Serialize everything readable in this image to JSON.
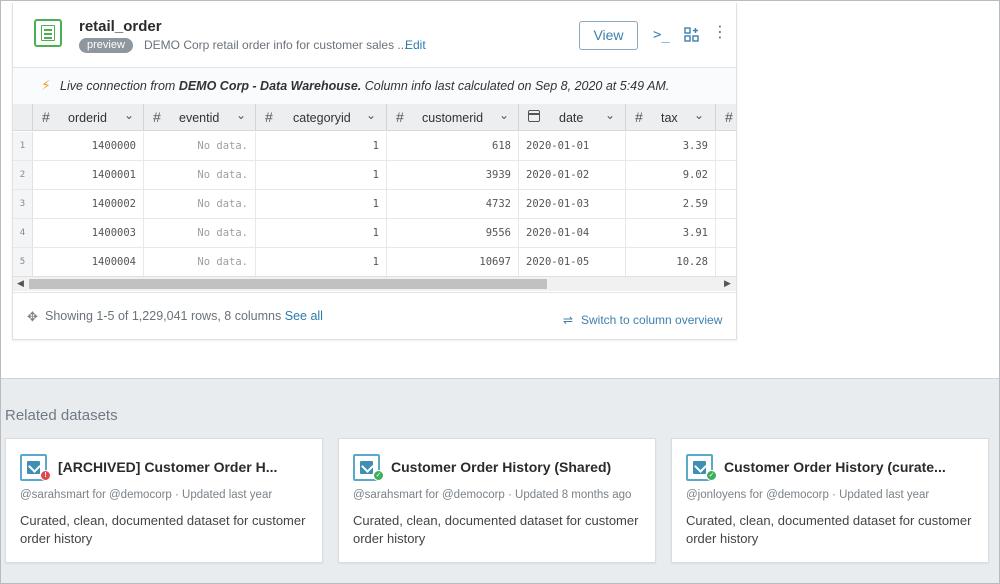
{
  "dataset": {
    "title": "retail_order",
    "badge": "preview",
    "description": "DEMO Corp retail order info for customer sales ...",
    "edit_label": "Edit",
    "view_label": "View",
    "icons": [
      "terminal-icon",
      "apps-icon",
      "more-icon"
    ]
  },
  "live_bar": {
    "prefix": "Live connection from ",
    "source": "DEMO Corp - Data Warehouse.",
    "suffix": " Column info last calculated on Sep 8, 2020 at 5:49 AM."
  },
  "table": {
    "columns": [
      {
        "name": "orderid",
        "type": "number"
      },
      {
        "name": "eventid",
        "type": "number"
      },
      {
        "name": "categoryid",
        "type": "number"
      },
      {
        "name": "customerid",
        "type": "number"
      },
      {
        "name": "date",
        "type": "date"
      },
      {
        "name": "tax",
        "type": "number"
      }
    ],
    "rows": [
      {
        "num": "1",
        "cells": [
          "1400000",
          "No data.",
          "1",
          "618",
          "2020-01-01",
          "3.39"
        ]
      },
      {
        "num": "2",
        "cells": [
          "1400001",
          "No data.",
          "1",
          "3939",
          "2020-01-02",
          "9.02"
        ]
      },
      {
        "num": "3",
        "cells": [
          "1400002",
          "No data.",
          "1",
          "4732",
          "2020-01-03",
          "2.59"
        ]
      },
      {
        "num": "4",
        "cells": [
          "1400003",
          "No data.",
          "1",
          "9556",
          "2020-01-04",
          "3.91"
        ]
      },
      {
        "num": "5",
        "cells": [
          "1400004",
          "No data.",
          "1",
          "10697",
          "2020-01-05",
          "10.28"
        ]
      }
    ]
  },
  "footer": {
    "showing": "Showing 1-5 of 1,229,041 rows, 8 columns",
    "see_all": "See all",
    "switch_label": "Switch to column overview"
  },
  "related": {
    "title": "Related datasets",
    "cards": [
      {
        "title": "[ARCHIVED] Customer Order H...",
        "meta": "@sarahsmart for @democorp  ·  Updated last year",
        "desc": "Curated, clean, documented dataset for customer order history",
        "status": "archived",
        "status_color": "#e0474c"
      },
      {
        "title": "Customer Order History (Shared)",
        "meta": "@sarahsmart for @democorp  ·  Updated 8 months ago",
        "desc": "Curated, clean, documented dataset for customer order history",
        "status": "ok",
        "status_color": "#3fae5a"
      },
      {
        "title": "Customer Order History (curate...",
        "meta": "@jonloyens for @democorp  ·  Updated last year",
        "desc": "Curated, clean, documented dataset for customer order history",
        "status": "ok",
        "status_color": "#3fae5a"
      }
    ]
  }
}
